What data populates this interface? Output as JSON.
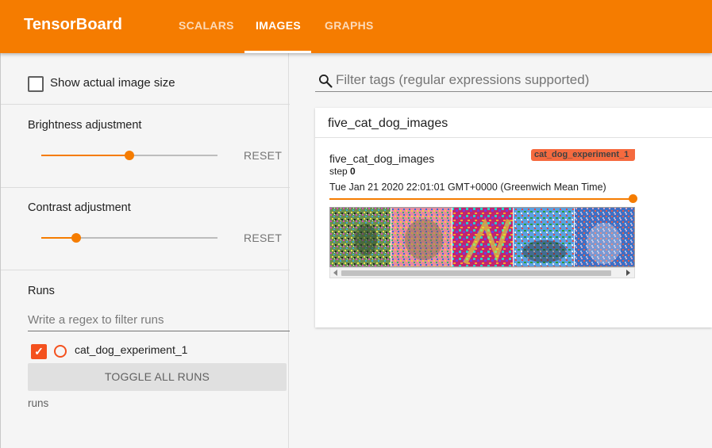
{
  "app": {
    "title": "TensorBoard",
    "accent": "#f57c00",
    "tabs": [
      {
        "label": "SCALARS",
        "active": false
      },
      {
        "label": "IMAGES",
        "active": true
      },
      {
        "label": "GRAPHS",
        "active": false
      }
    ]
  },
  "sidebar": {
    "show_actual_size": {
      "label": "Show actual image size",
      "checked": false
    },
    "brightness": {
      "label": "Brightness adjustment",
      "reset": "RESET",
      "value": 0.5
    },
    "contrast": {
      "label": "Contrast adjustment",
      "reset": "RESET",
      "value": 0.2
    },
    "runs": {
      "title": "Runs",
      "filter_placeholder": "Write a regex to filter runs",
      "items": [
        {
          "name": "cat_dog_experiment_1",
          "checked": true,
          "color": "#f4511e"
        }
      ],
      "toggle_all": "TOGGLE ALL RUNS",
      "footer": "runs"
    }
  },
  "main": {
    "filter_placeholder": "Filter tags (regular expressions supported)",
    "cards": [
      {
        "title": "five_cat_dog_images",
        "image_card": {
          "tag": "five_cat_dog_images",
          "run": "cat_dog_experiment_1",
          "step_label": "step",
          "step_value": "0",
          "timestamp": "Tue Jan 21 2020 22:01:01 GMT+0000 (Greenwich Mean Time)",
          "step_slider": 1.0
        }
      }
    ]
  }
}
